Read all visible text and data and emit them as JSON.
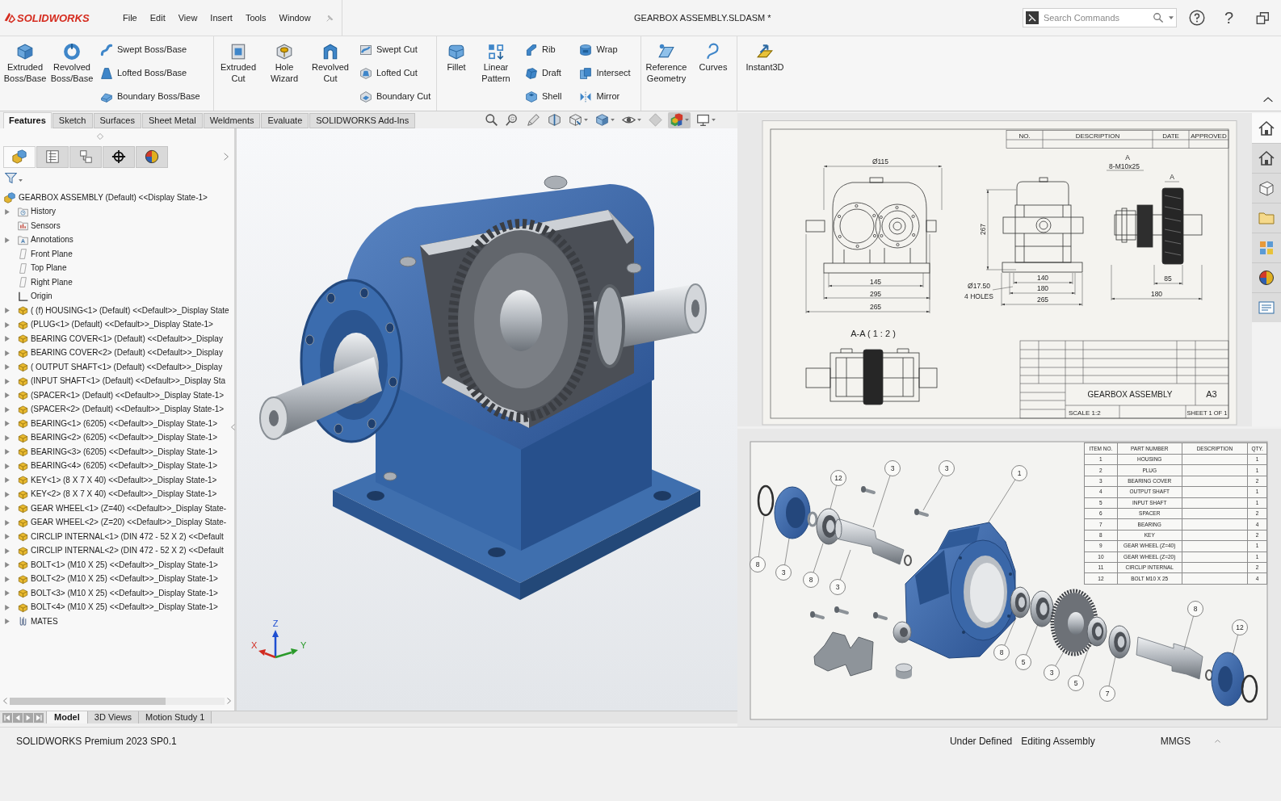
{
  "header": {
    "logo": "SOLIDWORKS",
    "menu": [
      "File",
      "Edit",
      "View",
      "Insert",
      "Tools",
      "Window"
    ],
    "title": "GEARBOX ASSEMBLY.SLDASM *",
    "search": {
      "placeholder": "Search Commands"
    },
    "help": "?"
  },
  "ribbon": {
    "groups": [
      {
        "columns": [
          {
            "kind": "large",
            "lines": [
              "Extruded",
              "Boss/Base"
            ]
          },
          {
            "kind": "large",
            "lines": [
              "Revolved",
              "Boss/Base"
            ]
          },
          {
            "kind": "stack",
            "items": [
              "Swept Boss/Base",
              "Lofted Boss/Base",
              "Boundary Boss/Base"
            ]
          }
        ]
      },
      {
        "columns": [
          {
            "kind": "large",
            "lines": [
              "Extruded",
              "Cut"
            ]
          },
          {
            "kind": "large",
            "lines": [
              "Hole",
              "Wizard"
            ]
          },
          {
            "kind": "large",
            "lines": [
              "Revolved",
              "Cut"
            ]
          },
          {
            "kind": "stack",
            "items": [
              "Swept Cut",
              "Lofted Cut",
              "Boundary Cut"
            ]
          }
        ]
      },
      {
        "columns": [
          {
            "kind": "large",
            "lines": [
              "Fillet"
            ]
          },
          {
            "kind": "large",
            "lines": [
              "Linear",
              "Pattern"
            ]
          },
          {
            "kind": "stack",
            "items": [
              "Rib",
              "Draft",
              "Shell"
            ]
          },
          {
            "kind": "stack",
            "items": [
              "Wrap",
              "Intersect",
              "Mirror"
            ]
          }
        ]
      },
      {
        "columns": [
          {
            "kind": "large",
            "lines": [
              "Reference",
              "Geometry"
            ]
          },
          {
            "kind": "large",
            "lines": [
              "Curves"
            ]
          }
        ]
      },
      {
        "columns": [
          {
            "kind": "large",
            "lines": [
              "Instant3D"
            ]
          }
        ]
      }
    ]
  },
  "command_tabs": [
    {
      "label": "Features",
      "selected": true
    },
    {
      "label": "Sketch",
      "selected": false
    },
    {
      "label": "Surfaces",
      "selected": false
    },
    {
      "label": "Sheet Metal",
      "selected": false
    },
    {
      "label": "Weldments",
      "selected": false
    },
    {
      "label": "Evaluate",
      "selected": false
    },
    {
      "label": "SOLIDWORKS Add-Ins",
      "selected": false
    }
  ],
  "view_tools": [
    {
      "selected": false
    },
    {
      "selected": false
    },
    {
      "selected": false
    },
    {
      "selected": false
    },
    {
      "selected": false
    },
    {
      "selected": false
    },
    {
      "selected": false
    },
    {
      "selected": false
    },
    {
      "selected": true
    },
    {
      "selected": false
    }
  ],
  "feature_manager": {
    "panel_tabs": [
      {
        "kind": "feature_tree",
        "selected": true
      },
      {
        "kind": "properties",
        "selected": false
      },
      {
        "kind": "configurations",
        "selected": false
      },
      {
        "kind": "dimxpert",
        "selected": false
      },
      {
        "kind": "display",
        "selected": false
      }
    ],
    "tree": {
      "label": "GEARBOX ASSEMBLY (Default) <<Display State-1>",
      "kind": "assembly",
      "children": [
        {
          "label": "History",
          "kind": "history",
          "expandable": true
        },
        {
          "label": "Sensors",
          "kind": "sensors",
          "expandable": false
        },
        {
          "label": "Annotations",
          "kind": "annotations",
          "expandable": true
        },
        {
          "label": "Front Plane",
          "kind": "plane",
          "expandable": false
        },
        {
          "label": "Top Plane",
          "kind": "plane",
          "expandable": false
        },
        {
          "label": "Right Plane",
          "kind": "plane",
          "expandable": false
        },
        {
          "label": "Origin",
          "kind": "origin",
          "expandable": false
        },
        {
          "label": "( (f) HOUSING<1> (Default) <<Default>>_Display State",
          "kind": "component",
          "expandable": true
        },
        {
          "label": "(PLUG<1> (Default) <<Default>>_Display State-1>",
          "kind": "component",
          "expandable": true
        },
        {
          "label": "BEARING COVER<1> (Default) <<Default>>_Display",
          "kind": "component",
          "expandable": true
        },
        {
          "label": "BEARING COVER<2> (Default) <<Default>>_Display",
          "kind": "component",
          "expandable": true
        },
        {
          "label": "( OUTPUT SHAFT<1> (Default) <<Default>>_Display",
          "kind": "component",
          "expandable": true
        },
        {
          "label": "(INPUT SHAFT<1> (Default) <<Default>>_Display Sta",
          "kind": "component",
          "expandable": true
        },
        {
          "label": "(SPACER<1> (Default) <<Default>>_Display State-1>",
          "kind": "component",
          "expandable": true
        },
        {
          "label": "(SPACER<2> (Default) <<Default>>_Display State-1>",
          "kind": "component",
          "expandable": true
        },
        {
          "label": "BEARING<1> (6205) <<Default>>_Display State-1>",
          "kind": "component",
          "expandable": true
        },
        {
          "label": "BEARING<2> (6205) <<Default>>_Display State-1>",
          "kind": "component",
          "expandable": true
        },
        {
          "label": "BEARING<3> (6205) <<Default>>_Display State-1>",
          "kind": "component",
          "expandable": true
        },
        {
          "label": "BEARING<4> (6205) <<Default>>_Display State-1>",
          "kind": "component",
          "expandable": true
        },
        {
          "label": "KEY<1> (8 X 7 X 40) <<Default>>_Display State-1>",
          "kind": "component",
          "expandable": true
        },
        {
          "label": "KEY<2> (8 X 7 X 40) <<Default>>_Display State-1>",
          "kind": "component",
          "expandable": true
        },
        {
          "label": "GEAR WHEEL<1> (Z=40) <<Default>>_Display State-",
          "kind": "component",
          "expandable": true
        },
        {
          "label": "GEAR WHEEL<2> (Z=20) <<Default>>_Display State-",
          "kind": "component",
          "expandable": true
        },
        {
          "label": "CIRCLIP INTERNAL<1> (DIN 472 - 52 X 2) <<Default",
          "kind": "component",
          "expandable": true
        },
        {
          "label": "CIRCLIP INTERNAL<2> (DIN 472 - 52 X 2) <<Default",
          "kind": "component",
          "expandable": true
        },
        {
          "label": "BOLT<1> (M10 X 25) <<Default>>_Display State-1>",
          "kind": "component",
          "expandable": true
        },
        {
          "label": "BOLT<2> (M10 X 25) <<Default>>_Display State-1>",
          "kind": "component",
          "expandable": true
        },
        {
          "label": "BOLT<3> (M10 X 25) <<Default>>_Display State-1>",
          "kind": "component",
          "expandable": true
        },
        {
          "label": "BOLT<4> (M10 X 25) <<Default>>_Display State-1>",
          "kind": "component",
          "expandable": true
        },
        {
          "label": "MATES",
          "kind": "mates",
          "expandable": true
        }
      ]
    }
  },
  "viewport": {
    "triad": {
      "x": "X",
      "y": "Y",
      "z": "Z"
    }
  },
  "model_tabs": [
    {
      "label": "Model",
      "selected": true
    },
    {
      "label": "3D Views",
      "selected": false
    },
    {
      "label": "Motion Study 1",
      "selected": false
    }
  ],
  "drawing_sheet": {
    "revision_table": {
      "columns": [
        "NO.",
        "DESCRIPTION",
        "DATE",
        "APPROVED"
      ]
    },
    "annotations": [
      "Ø115",
      "A",
      "8-M10x25",
      "A",
      "267",
      "145",
      "295",
      "265",
      "Ø17.50",
      "4 HOLES",
      "140",
      "180",
      "265",
      "85",
      "180"
    ],
    "section_label": "A-A ( 1 : 2 )",
    "title_block": {
      "title": "GEARBOX ASSEMBLY",
      "size": "A3",
      "scale": "SCALE 1:2",
      "sheet": "SHEET 1 OF 1"
    }
  },
  "task_pane": [
    {
      "selected": true
    },
    {
      "selected": false
    },
    {
      "selected": false
    },
    {
      "selected": false
    },
    {
      "selected": false
    },
    {
      "selected": false
    },
    {
      "selected": false
    }
  ],
  "exploded_view": {
    "balloons": [
      "3",
      "3",
      "1",
      "12",
      "8",
      "3",
      "8",
      "3",
      "8",
      "12",
      "8",
      "5",
      "3",
      "5",
      "7"
    ],
    "parts_list": {
      "columns": [
        "ITEM NO.",
        "PART NUMBER",
        "DESCRIPTION",
        "QTY."
      ],
      "rows": [
        {
          "item": "1",
          "part_number": "HOUSING",
          "qty": "1"
        },
        {
          "item": "2",
          "part_number": "PLUG",
          "qty": "1"
        },
        {
          "item": "3",
          "part_number": "BEARING COVER",
          "qty": "2"
        },
        {
          "item": "4",
          "part_number": "OUTPUT SHAFT",
          "qty": "1"
        },
        {
          "item": "5",
          "part_number": "INPUT SHAFT",
          "qty": "1"
        },
        {
          "item": "6",
          "part_number": "SPACER",
          "qty": "2"
        },
        {
          "item": "7",
          "part_number": "BEARING",
          "qty": "4"
        },
        {
          "item": "8",
          "part_number": "KEY",
          "qty": "2"
        },
        {
          "item": "9",
          "part_number": "GEAR WHEEL (Z=40)",
          "qty": "1"
        },
        {
          "item": "10",
          "part_number": "GEAR WHEEL (Z=20)",
          "qty": "1"
        },
        {
          "item": "11",
          "part_number": "CIRCLIP INTERNAL",
          "qty": "2"
        },
        {
          "item": "12",
          "part_number": "BOLT M10 X 25",
          "qty": "4"
        }
      ]
    }
  },
  "status_bar": {
    "product": "SOLIDWORKS Premium 2023 SP0.1",
    "state": "Under Defined",
    "mode": "Editing Assembly",
    "units": "MMGS"
  }
}
